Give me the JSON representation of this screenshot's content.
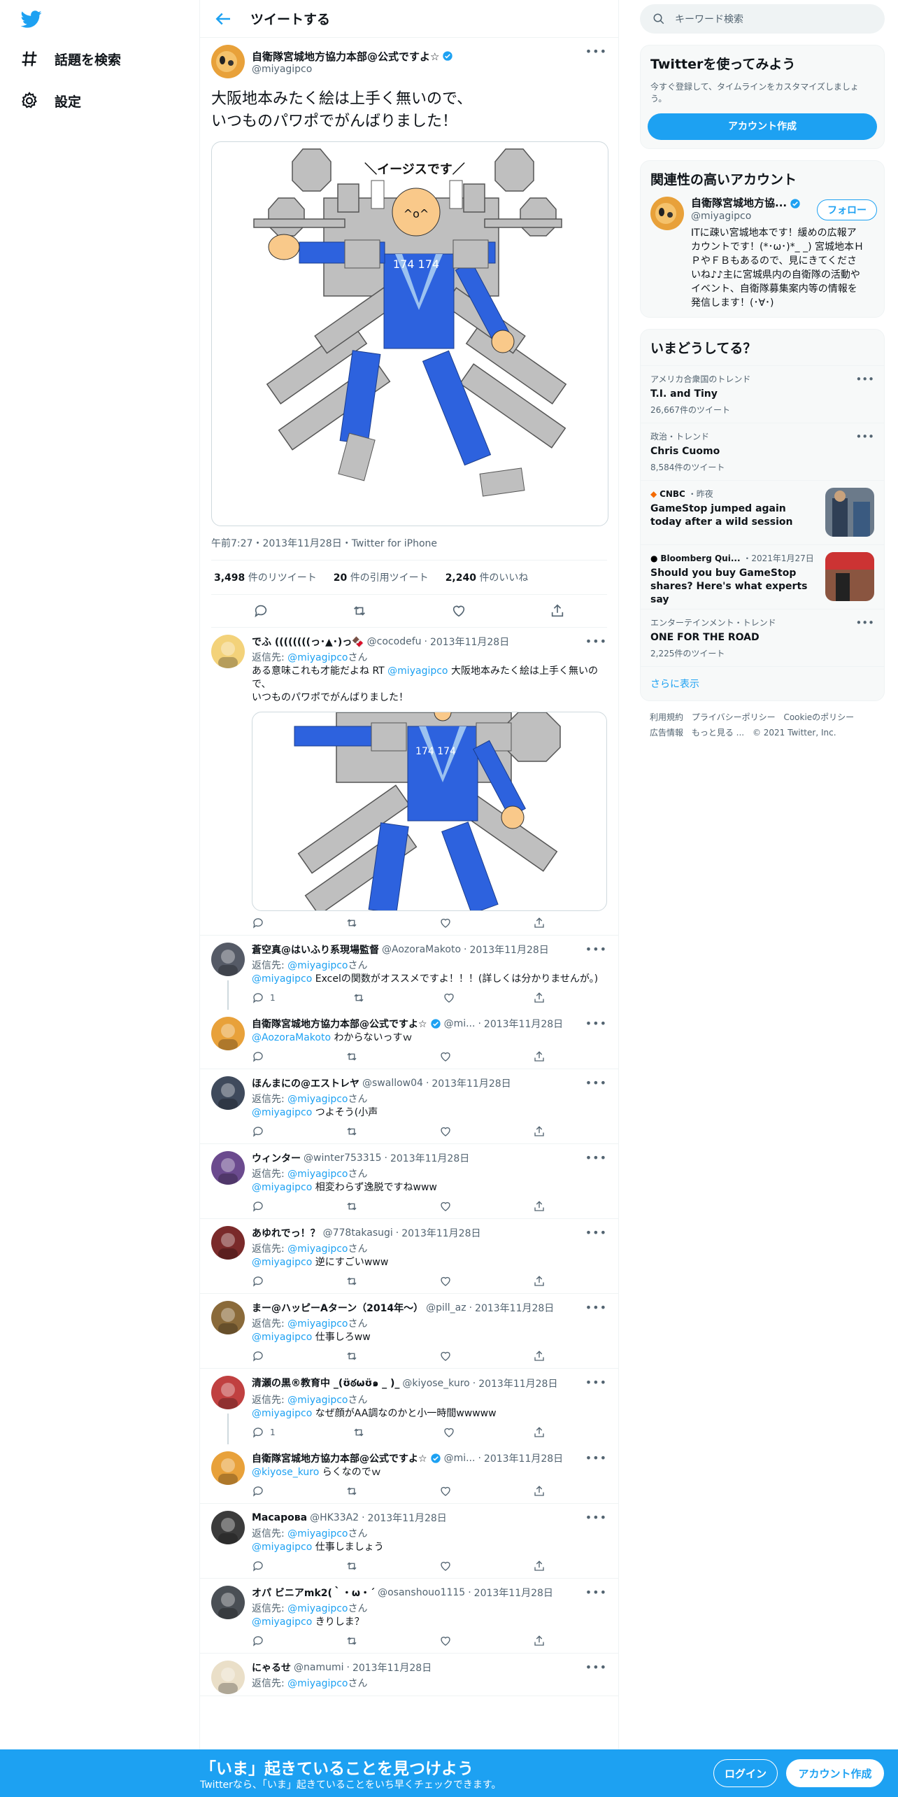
{
  "nav": {
    "explore": "話題を検索",
    "settings": "設定"
  },
  "header": {
    "title": "ツイートする"
  },
  "main_tweet": {
    "name": "自衛隊宮城地方協力本部@公式ですよ☆",
    "handle": "@miyagipco",
    "text_line1": "大阪地本みたく絵は上手く無いので、",
    "text_line2": "いつものパワポでがんばりました！",
    "image_caption": "＼イージスです／",
    "image_number": "174  174",
    "meta": "午前7:27・2013年11月28日・Twitter for iPhone",
    "retweets": "3,498",
    "retweets_label": "件のリツイート",
    "quotes": "20",
    "quotes_label": "件の引用ツイート",
    "likes": "2,240",
    "likes_label": "件のいいね"
  },
  "replies": [
    {
      "name": "でふ ((((((((っ･▲･)っ🍫",
      "handle": "@cocodefu",
      "date": "2013年11月28日",
      "to": "返信先: ",
      "to_link": "@miyagipco",
      "to_suffix": "さん",
      "text": "ある意味これも才能だよね RT ",
      "mention": "@miyagipco",
      "text2": " 大阪地本みたく絵は上手く無いので、",
      "text3": "いつものパワポでがんばりました！"
    },
    {
      "name": "蒼空真@はいふり系現場監督",
      "handle": "@AozoraMakoto",
      "date": "2013年11月28日",
      "to": "返信先: ",
      "to_link": "@miyagipco",
      "to_suffix": "さん",
      "mention": "@miyagipco",
      "text": " Excelの関数がオススメですよ！！！(詳しくは分かりませんが。)",
      "reply_count": "1"
    },
    {
      "name": "自衛隊宮城地方協力本部@公式ですよ☆",
      "handle": "@mi...",
      "date": "2013年11月28日",
      "mention": "@AozoraMakoto",
      "text": " わからないっすｗ"
    },
    {
      "name": "ほんまにの@エストレヤ",
      "handle": "@swallow04",
      "date": "2013年11月28日",
      "to": "返信先: ",
      "to_link": "@miyagipco",
      "to_suffix": "さん",
      "mention": "@miyagipco",
      "text": " つよそう(小声"
    },
    {
      "name": "ウィンター",
      "handle": "@winter753315",
      "date": "2013年11月28日",
      "to": "返信先: ",
      "to_link": "@miyagipco",
      "to_suffix": "さん",
      "mention": "@miyagipco",
      "text": " 相変わらず逸脱ですねwww"
    },
    {
      "name": "あゆれでっ！？",
      "handle": "@778takasugi",
      "date": "2013年11月28日",
      "to": "返信先: ",
      "to_link": "@miyagipco",
      "to_suffix": "さん",
      "mention": "@miyagipco",
      "text": " 逆にすごいwww"
    },
    {
      "name": "まー@ハッピーAターン（2014年～）",
      "handle": "@pill_az",
      "date": "2013年11月28日",
      "to": "返信先: ",
      "to_link": "@miyagipco",
      "to_suffix": "さん",
      "mention": "@miyagipco",
      "text": " 仕事しろww"
    },
    {
      "name": "清瀬の黒®教育中 _(ʊ̈ఠωʊ̈๑ _ )_",
      "handle": "@kiyose_kuro",
      "date": "2013年11月28日",
      "to": "返信先: ",
      "to_link": "@miyagipco",
      "to_suffix": "さん",
      "mention": "@miyagipco",
      "text": " なぜ顔がAA調なのかと小一時間wwwww",
      "reply_count": "1"
    },
    {
      "name": "自衛隊宮城地方協力本部@公式ですよ☆",
      "handle": "@mi...",
      "date": "2013年11月28日",
      "mention": "@kiyose_kuro",
      "text": " らくなのでｗ"
    },
    {
      "name": "Масарова",
      "handle": "@HK33A2",
      "date": "2013年11月28日",
      "to": "返信先: ",
      "to_link": "@miyagipco",
      "to_suffix": "さん",
      "mention": "@miyagipco",
      "text": "  仕事しましょう"
    },
    {
      "name": "オパ ビニアmk2(｀・ω・´",
      "handle": "@osanshouo1115",
      "date": "2013年11月28日",
      "to": "返信先: ",
      "to_link": "@miyagipco",
      "to_suffix": "さん",
      "mention": "@miyagipco",
      "text": " きりしま？"
    },
    {
      "name": "にゃるせ",
      "handle": "@namumi",
      "date": "2013年11月28日",
      "to": "返信先: ",
      "to_link": "@miyagipco",
      "to_suffix": "さん"
    }
  ],
  "sidebar": {
    "search_placeholder": "キーワード検索",
    "signup_title": "Twitterを使ってみよう",
    "signup_desc": "今すぐ登録して、タイムラインをカスタマイズしましょう。",
    "signup_button": "アカウント作成",
    "related_title": "関連性の高いアカウント",
    "related_name": "自衛隊宮城地方協...",
    "related_handle": "@miyagipco",
    "related_bio": "ITに疎い宮城地本です！緩めの広報アカウントです！(*･ω･)*_ _) 宮城地本ＨＰやＦＢもあるので、見にきてくださいね♪♪主に宮城県内の自衛隊の活動やイベント、自衛隊募集案内等の情報を発信します！(･∀･)",
    "follow_button": "フォロー",
    "trends_title": "いまどうしてる？",
    "trends": [
      {
        "category": "アメリカ合衆国のトレンド",
        "title": "T.I. and Tiny",
        "count": "26,667件のツイート"
      },
      {
        "category": "政治・トレンド",
        "title": "Chris Cuomo",
        "count": "8,584件のツイート"
      },
      {
        "source": "CNBC",
        "time": "・昨夜",
        "title": "GameStop jumped again today after a wild session"
      },
      {
        "source": "Bloomberg Qui...",
        "time": "・2021年1月27日",
        "title": "Should you buy GameStop shares? Here's what experts say"
      },
      {
        "category": "エンターテインメント・トレンド",
        "title": "ONE FOR THE ROAD",
        "count": "2,225件のツイート"
      }
    ],
    "show_more": "さらに表示",
    "footer": [
      "利用規約",
      "プライバシーポリシー",
      "Cookieのポリシー",
      "広告情報",
      "もっと見る ...",
      "© 2021 Twitter, Inc."
    ]
  },
  "bottom_bar": {
    "title": "「いま」起きていることを見つけよう",
    "subtitle": "Twitterなら、「いま」起きていることをいち早くチェックできます。",
    "login": "ログイン",
    "signup": "アカウント作成"
  }
}
